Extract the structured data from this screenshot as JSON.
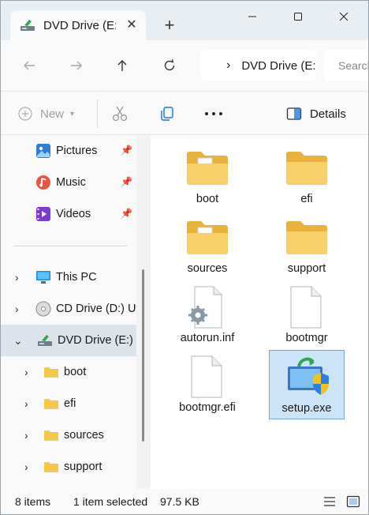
{
  "window": {
    "tab_title": "DVD Drive (E:)",
    "new_tab": "+",
    "close_tab": "✕"
  },
  "address": {
    "path": "DVD Drive (E:)",
    "search_placeholder": "Search DVD Drive (E:)"
  },
  "commandbar": {
    "new_label": "New",
    "details_label": "Details"
  },
  "nav": {
    "quick_access": [
      {
        "label": "Pictures",
        "icon": "pictures-icon"
      },
      {
        "label": "Music",
        "icon": "music-icon"
      },
      {
        "label": "Videos",
        "icon": "videos-icon"
      }
    ],
    "this_pc": "This PC",
    "cd_drive": "CD Drive (D:) U",
    "dvd_drive": "DVD Drive (E:) I",
    "folders": [
      "boot",
      "efi",
      "sources",
      "support"
    ]
  },
  "files": [
    {
      "name": "boot",
      "type": "folder-with-doc"
    },
    {
      "name": "efi",
      "type": "folder"
    },
    {
      "name": "sources",
      "type": "folder-with-doc"
    },
    {
      "name": "support",
      "type": "folder"
    },
    {
      "name": "autorun.inf",
      "type": "settings-file"
    },
    {
      "name": "bootmgr",
      "type": "blank-file"
    },
    {
      "name": "bootmgr.efi",
      "type": "blank-file"
    },
    {
      "name": "setup.exe",
      "type": "setup-exe"
    }
  ],
  "status": {
    "items": "8 items",
    "selected": "1 item selected",
    "size": "97.5 KB"
  },
  "colors": {
    "accent": "#1a73d9",
    "folder": "#f5c84c",
    "selected_bg": "#cce4f7"
  }
}
